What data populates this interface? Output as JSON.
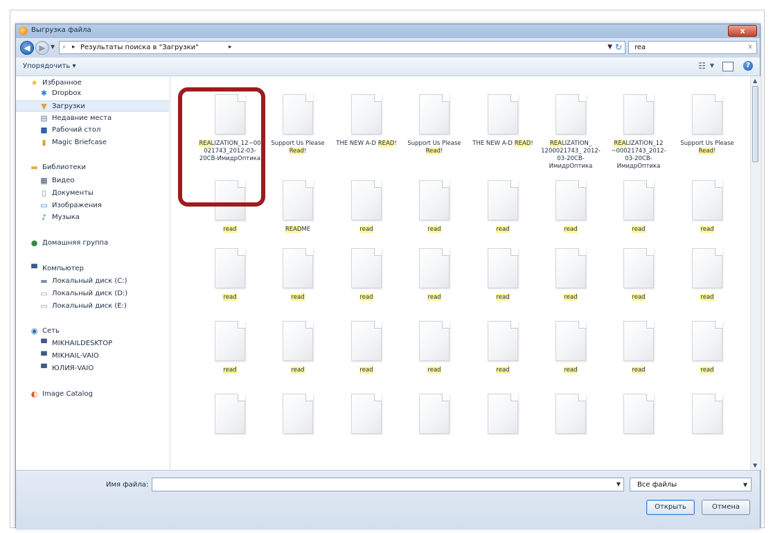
{
  "window": {
    "title": "Выгрузка файла",
    "close_label": "x"
  },
  "address": {
    "back_icon": "back-arrow-icon",
    "forward_icon": "forward-arrow-icon",
    "path_separator": "▸",
    "path": "Результаты поиска в \"Загрузки\"",
    "refresh_icon": "refresh-icon",
    "search_value": "rea",
    "search_clear": "x"
  },
  "toolbar": {
    "organize_label": "Упорядочить ▾"
  },
  "sidebar": {
    "items": [
      {
        "label": "Избранное",
        "icon": "star-icon",
        "glyph": "★",
        "color": "#f2b51d"
      },
      {
        "label": "Dropbox",
        "icon": "dropbox-icon",
        "glyph": "✱",
        "color": "#2a83d6"
      },
      {
        "label": "Загрузки",
        "icon": "downloads-folder-icon",
        "glyph": "▼",
        "color": "#d9a43a"
      },
      {
        "label": "Недавние места",
        "icon": "recent-places-icon",
        "glyph": "▤",
        "color": "#6e7f98"
      },
      {
        "label": "Рабочий стол",
        "icon": "desktop-icon",
        "glyph": "■",
        "color": "#2d5fa6"
      },
      {
        "label": "Magic Briefcase",
        "icon": "briefcase-icon",
        "glyph": "▮",
        "color": "#d8a735"
      },
      {
        "label": "Библиотеки",
        "icon": "libraries-icon",
        "glyph": "▬",
        "color": "#e0b04a"
      },
      {
        "label": "Видео",
        "icon": "video-icon",
        "glyph": "▦",
        "color": "#39506f"
      },
      {
        "label": "Документы",
        "icon": "documents-icon",
        "glyph": "▯",
        "color": "#6f86a5"
      },
      {
        "label": "Изображения",
        "icon": "pictures-icon",
        "glyph": "▭",
        "color": "#3a7ab8"
      },
      {
        "label": "Музыка",
        "icon": "music-icon",
        "glyph": "♪",
        "color": "#2a6fc2"
      },
      {
        "label": "Домашняя группа",
        "icon": "homegroup-icon",
        "glyph": "●",
        "color": "#2f8a3a"
      },
      {
        "label": "Компьютер",
        "icon": "computer-icon",
        "glyph": "▀",
        "color": "#3c5a84"
      },
      {
        "label": "Локальный диск (C:)",
        "icon": "disk-c-icon",
        "glyph": "▬",
        "color": "#7d8ea6"
      },
      {
        "label": "Локальный диск (D:)",
        "icon": "disk-d-icon",
        "glyph": "▭",
        "color": "#8d9cb1"
      },
      {
        "label": "Локальный диск (E:)",
        "icon": "disk-e-icon",
        "glyph": "▭",
        "color": "#8d9cb1"
      },
      {
        "label": "Сеть",
        "icon": "network-icon",
        "glyph": "◉",
        "color": "#2c6bb5"
      },
      {
        "label": "MIKHAILDESKTOP",
        "icon": "network-computer-icon",
        "glyph": "▀",
        "color": "#3c5a84"
      },
      {
        "label": "MIKHAIL-VAIO",
        "icon": "network-computer-icon",
        "glyph": "▀",
        "color": "#3c5a84"
      },
      {
        "label": "ЮЛИЯ-VAIO",
        "icon": "network-computer-icon",
        "glyph": "▀",
        "color": "#3c5a84"
      },
      {
        "label": "Image Catalog",
        "icon": "image-catalog-icon",
        "glyph": "◐",
        "color": "#e2582b"
      }
    ]
  },
  "files": [
    {
      "name": "REALIZATION_12~00021743_2012-03-20CB-ИмидрОптика",
      "hl": "REA"
    },
    {
      "name": "Support Us Please Read!",
      "hl": "Read"
    },
    {
      "name": "THE NEW A-D READ!",
      "hl": "READ"
    },
    {
      "name": "Support Us Please Read!",
      "hl": "Read"
    },
    {
      "name": "THE NEW A-D READ!",
      "hl": "READ"
    },
    {
      "name": "REALIZATION_ 1200021743_ 2012-03-20CB-ИмидрОптика",
      "hl": "REA"
    },
    {
      "name": "REALIZATION_12 ~00021743_2012-03-20CB-ИмидрОптика",
      "hl": "REA"
    },
    {
      "name": "Support Us Please Read!",
      "hl": "Read"
    },
    {
      "name": "read",
      "hl": "read"
    },
    {
      "name": "README",
      "hl": "READ"
    },
    {
      "name": "read",
      "hl": "read"
    },
    {
      "name": "read",
      "hl": "read"
    },
    {
      "name": "read",
      "hl": "read"
    },
    {
      "name": "read",
      "hl": "read"
    },
    {
      "name": "read",
      "hl": "read"
    },
    {
      "name": "read",
      "hl": "read"
    },
    {
      "name": "read",
      "hl": "read"
    },
    {
      "name": "read",
      "hl": "read"
    },
    {
      "name": "read",
      "hl": "read"
    },
    {
      "name": "read",
      "hl": "read"
    },
    {
      "name": "read",
      "hl": "read"
    },
    {
      "name": "read",
      "hl": "read"
    },
    {
      "name": "read",
      "hl": "read"
    },
    {
      "name": "read",
      "hl": "read"
    },
    {
      "name": "read",
      "hl": "read"
    },
    {
      "name": "read",
      "hl": "read"
    },
    {
      "name": "read",
      "hl": "read"
    },
    {
      "name": "read",
      "hl": "read"
    },
    {
      "name": "read",
      "hl": "read"
    },
    {
      "name": "read",
      "hl": "read"
    },
    {
      "name": "read",
      "hl": "read"
    },
    {
      "name": "read",
      "hl": "read"
    },
    {
      "name": "",
      "hl": ""
    },
    {
      "name": "",
      "hl": ""
    },
    {
      "name": "",
      "hl": ""
    },
    {
      "name": "",
      "hl": ""
    },
    {
      "name": "",
      "hl": ""
    },
    {
      "name": "",
      "hl": ""
    },
    {
      "name": "",
      "hl": ""
    },
    {
      "name": "",
      "hl": ""
    }
  ],
  "bottom": {
    "filename_label": "Имя файла:",
    "filename_value": "",
    "filetype_value": "Все файлы",
    "open_label": "Открыть",
    "cancel_label": "Отмена"
  },
  "colors": {
    "highlight_box": "#9e1b1e",
    "search_highlight": "#fff59a"
  }
}
